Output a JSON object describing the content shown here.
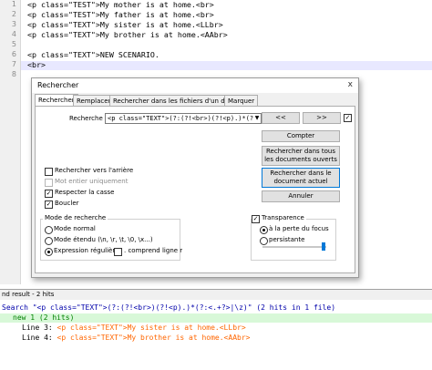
{
  "editor": {
    "line_numbers": [
      "1",
      "2",
      "3",
      "4",
      "5",
      "6",
      "7",
      "8",
      "9"
    ],
    "lines": [
      "<p class=\"TEST\">My mother is at home.<br>",
      "<p class=\"TEST\">My father is at home.<br>",
      "<p class=\"TEXT\">My sister is at home.<LLbr>",
      "<p class=\"TEXT\">My brother is at home.<AAbr>",
      "",
      "<p class=\"TEXT\">NEW SCENARIO.",
      "<br>",
      "",
      ""
    ]
  },
  "dialog": {
    "title": "Rechercher",
    "close": "x",
    "tabs": [
      "Rechercher",
      "Remplacer",
      "Rechercher dans les fichiers d'un dossier",
      "Marquer"
    ],
    "search_label": "Recherche :",
    "search_value": "<p class=\"TEXT\">(?:(?!<br>)(?!<p).)*(?:<.+?>|\\",
    "prev_button": "<<",
    "next_button": ">>",
    "count_button": "Compter",
    "search_all_docs_button": "Rechercher dans tous les documents ouverts",
    "search_current_doc_button": "Rechercher dans le document actuel",
    "cancel_button": "Annuler",
    "options": {
      "backward": "Rechercher vers l'arrière",
      "whole_word": "Mot entier uniquement",
      "match_case": "Respecter la casse",
      "wrap": "Boucler"
    },
    "mode_group_title": "Mode de recherche",
    "modes": {
      "normal": "Mode normal",
      "extended": "Mode étendu (\\n, \\r, \\t, \\0, \\x...)",
      "regex": "Expression régulière",
      "dot_newline": ". comprend ligne r"
    },
    "transparency_title": "Transparence",
    "transparency_options": {
      "on_focus_loss": "à la perte du focus",
      "always": "persistante"
    }
  },
  "results": {
    "header": "nd result - 2 hits",
    "search_line": "Search \"<p class=\"TEXT\">(?:(?!<br>)(?!<p).)*(?:<.+?>|\\z)\" (2 hits in 1 file)",
    "file_line": "new 1 (2 hits)",
    "hits": [
      {
        "label": "Line 3: ",
        "text": "<p class=\"TEXT\">My sister is at home.<LLbr>"
      },
      {
        "label": "Line 4: ",
        "text": "<p class=\"TEXT\">My brother is at home.<AAbr>"
      }
    ]
  },
  "colors": {
    "accent": "#0078d7",
    "search_term": "#0000aa",
    "hit_text": "#ff6600",
    "file_highlight": "#d8f8d8"
  }
}
